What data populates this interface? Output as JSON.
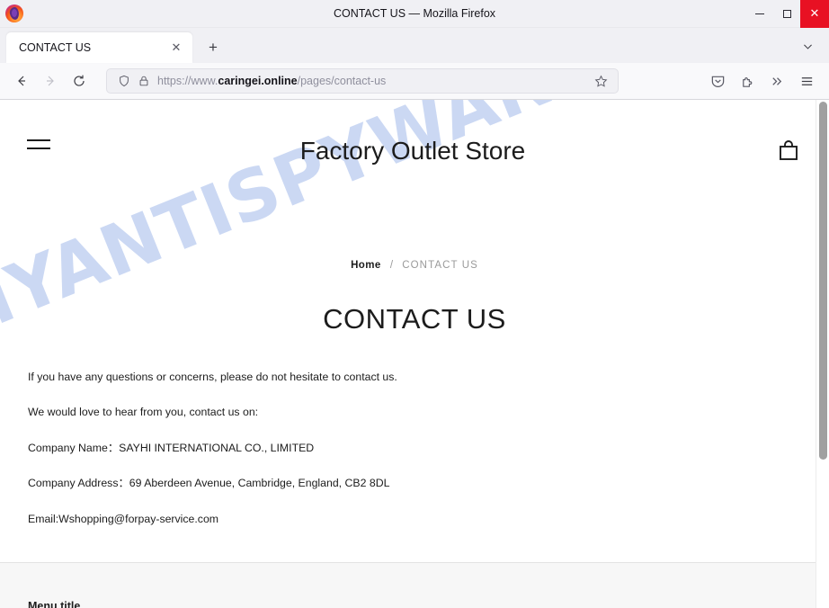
{
  "browser": {
    "window_title": "CONTACT US — Mozilla Firefox",
    "logo_icon": "firefox-logo",
    "window_controls": {
      "minimize_label": "—",
      "maximize_label": "□",
      "close_label": "✕",
      "close_color": "#e81123"
    },
    "tabs": [
      {
        "label": "CONTACT US",
        "close_label": "✕",
        "active": true
      }
    ],
    "new_tab_label": "+",
    "tab_list_icon": "chevron-down-icon",
    "nav": {
      "back_icon": "back-arrow-icon",
      "forward_icon": "forward-arrow-icon",
      "reload_icon": "reload-icon"
    },
    "urlbar": {
      "shield_icon": "shield-icon",
      "lock_icon": "lock-icon",
      "url_prefix": "https://www.",
      "url_host": "caringei.online",
      "url_path": "/pages/contact-us",
      "bookmark_icon": "star-icon"
    },
    "toolbar_right": [
      {
        "icon": "pocket-save-icon"
      },
      {
        "icon": "extensions-puzzle-icon"
      },
      {
        "icon": "overflow-chevrons-icon"
      },
      {
        "icon": "application-menu-icon"
      }
    ]
  },
  "page": {
    "watermark_text": "MYANTISPYWARE.COM",
    "watermark_color": "#c2d2f2",
    "header": {
      "menu_icon": "hamburger-menu-icon",
      "site_title": "Factory Outlet Store",
      "cart_icon": "shopping-bag-icon"
    },
    "breadcrumb": {
      "home_label": "Home",
      "separator": "/",
      "current_label": "CONTACT US"
    },
    "title": "CONTACT US",
    "paragraphs": [
      "If you have any questions or concerns, please do not hesitate to contact us.",
      "We would love to hear from you, contact us on:",
      "Company Name：SAYHI INTERNATIONAL CO., LIMITED",
      "Company Address：69 Aberdeen Avenue, Cambridge, England, CB2 8DL",
      "Email:Wshopping@forpay-service.com"
    ],
    "footer": {
      "menu_title": "Menu title"
    }
  }
}
